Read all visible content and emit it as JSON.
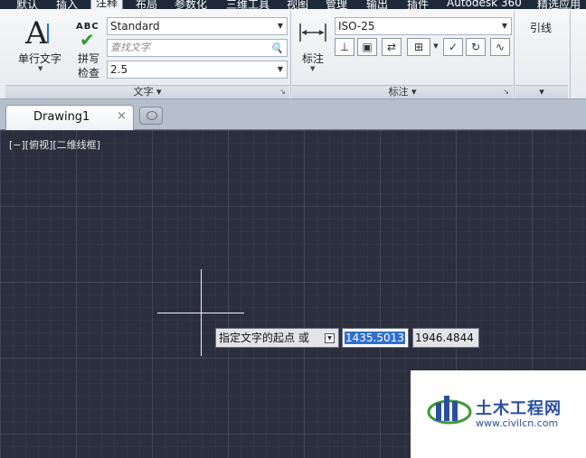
{
  "menu": {
    "tabs": [
      "默认",
      "插入",
      "注释",
      "布局",
      "参数化",
      "三维工具",
      "视图",
      "管理",
      "输出",
      "插件",
      "Autodesk 360",
      "精选应用"
    ],
    "active_index": 2
  },
  "ribbon": {
    "text_panel": {
      "multiline_text_label": "单行文字",
      "spellcheck_label_1": "拼写",
      "spellcheck_label_2": "检查",
      "abc_icon_text": "ABC",
      "text_style_value": "Standard",
      "find_text_placeholder": "查找文字",
      "text_height_value": "2.5",
      "footer_label": "文字"
    },
    "annotation_panel": {
      "dimension_label": "标注",
      "dim_style_value": "ISO-25",
      "footer_label": "标注"
    },
    "leader_panel": {
      "leader_label": "引线"
    }
  },
  "document_tabs": [
    {
      "name": "Drawing1",
      "close_glyph": "×"
    }
  ],
  "viewport": {
    "label": "[−][俯视][二维线框]"
  },
  "command_prompt": {
    "text": "指定文字的起点 或",
    "x_value": "1435.5013",
    "y_value": "1946.4844"
  },
  "watermark": {
    "title": "土木工程网",
    "url": "www.civilcn.com"
  },
  "colors": {
    "canvas_bg": "#2b2f3d",
    "accent_blue": "#2f6fd0",
    "watermark_blue": "#2b4fa0"
  }
}
